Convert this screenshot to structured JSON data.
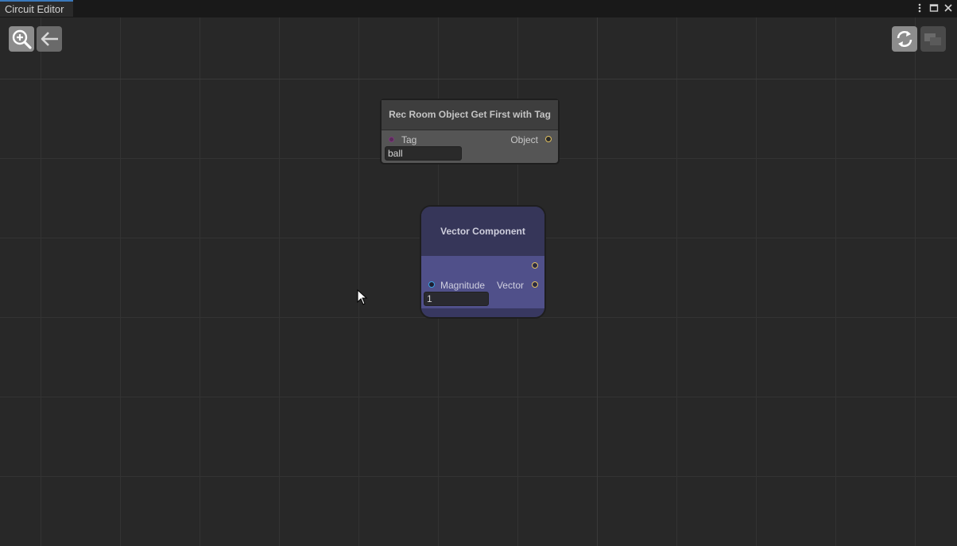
{
  "window": {
    "tab_title": "Circuit Editor",
    "controls": [
      "more-icon",
      "maximize-icon",
      "close-icon"
    ]
  },
  "toolbar": {
    "left": [
      "zoom-in-icon",
      "back-arrow-icon"
    ],
    "right": [
      "refresh-icon",
      "toggle-view-icon"
    ]
  },
  "nodes": {
    "rec_room": {
      "title": "Rec Room Object Get First with Tag",
      "input_label": "Tag",
      "output_label": "Object",
      "input_value": "ball",
      "colors": {
        "header": "#3e3e3e",
        "body": "#555555",
        "input_port": "#7a3a7a",
        "output_port": "#e0c060"
      }
    },
    "vector_component": {
      "title": "Vector Component",
      "input_label": "Magnitude",
      "output_label": "Vector",
      "input_value": "1",
      "colors": {
        "header": "#363659",
        "body": "#50508a",
        "input_port": "#3aa0e0",
        "output_port": "#e0c060"
      }
    }
  },
  "colors": {
    "canvas_bg": "#282828",
    "grid_line": "#333333",
    "tab_accent": "#3a79bb"
  }
}
